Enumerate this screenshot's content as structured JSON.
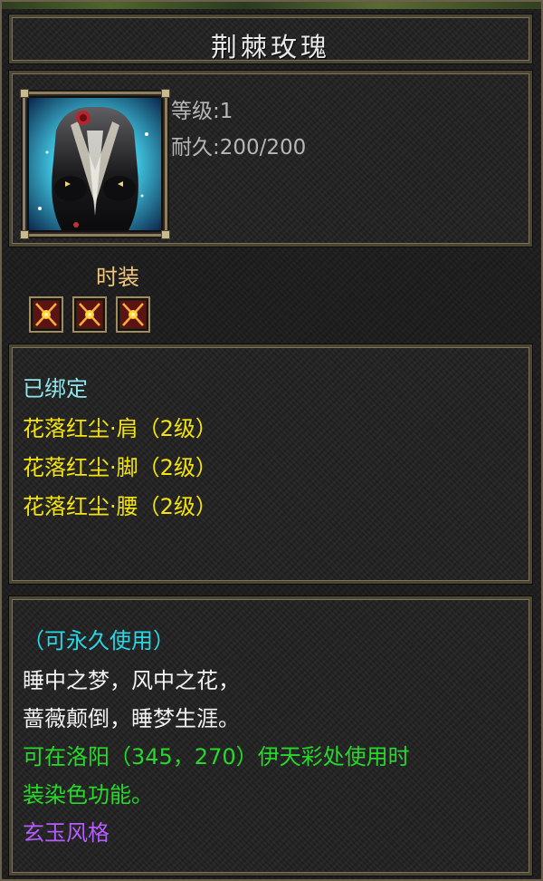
{
  "item": {
    "name": "荆棘玫瑰",
    "level_text": "等级:1",
    "durability_text": "耐久:200/200",
    "type": "时装",
    "socket_count": 3,
    "bound_text": "已绑定",
    "set_properties": [
      "花落红尘·肩（2级）",
      "花落红尘·脚（2级）",
      "花落红尘·腰（2级）"
    ],
    "usage_text": "（可永久使用）",
    "flavor_lines": [
      "睡中之梦，风中之花，",
      "蔷薇颠倒，睡梦生涯。"
    ],
    "dye_lines": [
      "可在洛阳（345，270）伊天彩处使用时",
      "装染色功能。"
    ],
    "style_text": "玄玉风格"
  },
  "colors": {
    "title": "#e8e8e8",
    "stat": "#b7b7b7",
    "type": "#f1c57a",
    "bound": "#8fe6ea",
    "set_property": "#f4e30c",
    "usage": "#27d8e6",
    "flavor": "#f2f2f2",
    "dye": "#27d92a",
    "style": "#b65cff"
  },
  "icons": {
    "item_icon": "dark-dress-with-rose-icon",
    "socket_icon": "red-gem-socket-icon"
  }
}
